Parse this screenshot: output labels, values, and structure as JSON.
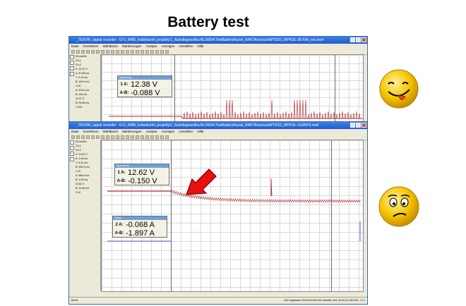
{
  "slide": {
    "title": "Battery test"
  },
  "window_top": {
    "title": "_TEXVIK_signal recorder - G:\\1_8485_individuelni_projekty\\1_Autodiagnostika ALLW3\\4.TestBatteryRucek_RAKTA\\versus\\WTU\\01_MPK\\3L-05-66h_xxx.mwf",
    "menu": [
      "Datei",
      "Korrelieren",
      "Wählbares",
      "Markierungen",
      "Analyse",
      "Anzeigen",
      "Umstellen",
      "Hilfe"
    ],
    "sidebar": [
      "50 ms/Div",
      "Ch-1",
      "Ch-2",
      "X: 12.37 V",
      "A: 87.85 ms",
      "Y: 0.15 mV",
      "B: 100.0 mV",
      "1.2V",
      "A: 476.2 ms",
      "B: 134 ms",
      "12.37 V",
      "B: 94.66 ms",
      "1.200"
    ],
    "meas": {
      "header": "Spannung",
      "rows": [
        {
          "ch": "1 A:",
          "val": "12.38 V"
        },
        {
          "ch": "A-B:",
          "val": "-0.088 V"
        }
      ]
    }
  },
  "window_bottom": {
    "title": "_TEXVIK_signal recorder - G:\\1_8485_individuelni_projekty\\1_Autodiagnostika ALLW3\\4.TestBatteryRucek_RAKTA\\versus\\WTU\\01_MPK\\3L-110A\\H1.mwf",
    "menu": [
      "Datei",
      "Korrelieren",
      "Wählbares",
      "Markierungen",
      "Analyse",
      "Anzeigen",
      "Umstellen",
      "Hilfe"
    ],
    "sidebar": [
      "50 ms/Div",
      "Ch-1",
      "Ch-2",
      "X: 12.62 V",
      "A: 1.46 ms",
      "Y: 6.42 mV",
      "B: 100.0 mV",
      "1.2V",
      "A: 566.9 ms",
      "B: 1.03 ms",
      "12.62 V",
      "B: 19.80 ms",
      "3.10"
    ],
    "meas_voltage": {
      "header": "Spannung",
      "rows": [
        {
          "ch": "1 A:",
          "val": "12.62 V"
        },
        {
          "ch": "A-B:",
          "val": "-0.150 V"
        }
      ]
    },
    "meas_current": {
      "header": "Strom",
      "rows": [
        {
          "ch": "2 A:",
          "val": "-0.068 A"
        },
        {
          "ch": "A-B:",
          "val": "-1.897 A"
        }
      ]
    },
    "status_left": "Bereit",
    "status_right": "Zeit insgesamt: 00:00:00.540.000, Aktuelle Zeit: 00:00:21.440.000 : 17:1"
  },
  "faces": {
    "top": "happy-tongue-face-icon",
    "bottom": "worried-face-icon"
  },
  "colors": {
    "signal": "#b0232a",
    "arrow": "#e81010",
    "face": "#f5c400"
  }
}
